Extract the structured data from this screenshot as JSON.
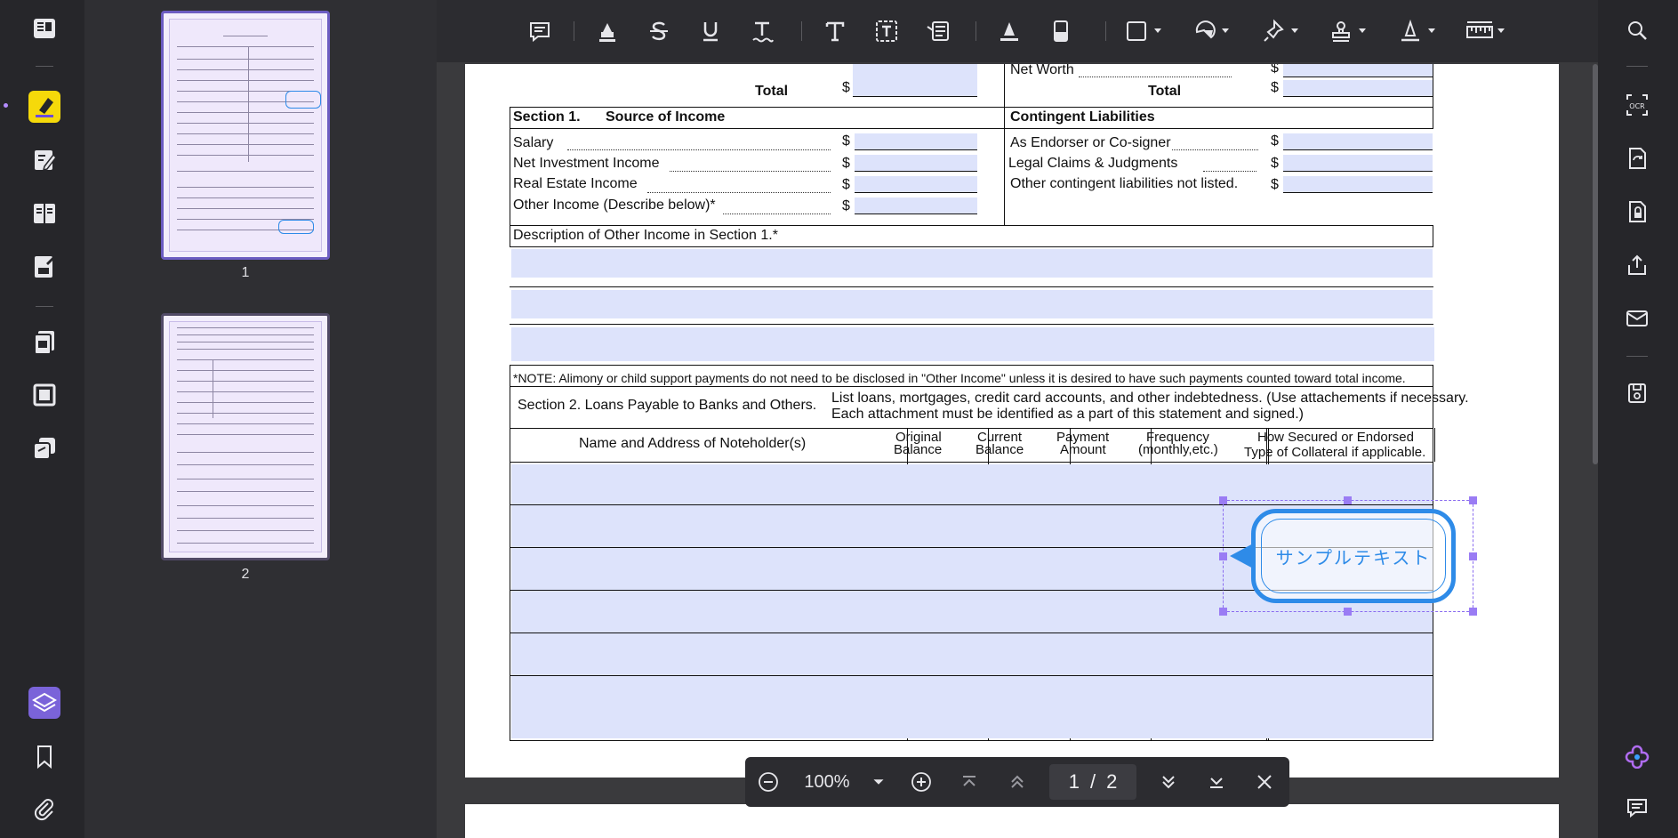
{
  "toolbar": {
    "tools": [
      "comment",
      "highlight",
      "strikethrough",
      "underline",
      "squiggly-underline",
      "text",
      "text-box",
      "text-callout",
      "pencil",
      "eraser",
      "shape",
      "area",
      "pin",
      "stamp",
      "signature",
      "measure"
    ]
  },
  "left_rail": {
    "items": [
      "reader",
      "comment",
      "edit",
      "organize",
      "form",
      "convert",
      "crop",
      "batch",
      "layers",
      "bookmark",
      "attachment"
    ]
  },
  "thumbnails": {
    "pages": [
      {
        "number": "1",
        "selected": true
      },
      {
        "number": "2",
        "selected": false
      }
    ]
  },
  "document": {
    "top_left_total": "Total",
    "top_left_currency": "$",
    "net_worth": "Net Worth",
    "net_worth_currency": "$",
    "top_right_total": "Total",
    "top_right_currency": "$",
    "section1_label": "Section 1.",
    "section1_title": "Source of Income",
    "contingent_title": "Contingent Liabilities",
    "income_rows": [
      {
        "label": "Salary",
        "currency": "$"
      },
      {
        "label": "Net Investment Income",
        "currency": "$"
      },
      {
        "label": "Real Estate Income",
        "currency": "$"
      },
      {
        "label": "Other Income (Describe below)*",
        "currency": "$"
      }
    ],
    "contingent_rows": [
      {
        "label": "As Endorser or Co-signer",
        "currency": "$"
      },
      {
        "label": "Legal Claims & Judgments",
        "currency": "$"
      },
      {
        "label": "Other contingent liabilities not listed.",
        "currency": "$"
      }
    ],
    "description_label": "Description of Other Income in Section 1.*",
    "note": "*NOTE: Alimony or child support payments do not need to be disclosed in \"Other Income\" unless it is desired to have such payments counted toward total income.",
    "section2_title": "Section 2. Loans Payable to Banks and Others.",
    "section2_instr_1": "List loans, mortgages, credit card accounts, and other indebtedness. (Use attachements if necessary.",
    "section2_instr_2": "Each attachment must be identified as a part of this statement and signed.)",
    "columns": {
      "name": "Name and Address of Noteholder(s)",
      "original_1": "Original",
      "original_2": "Balance",
      "current_1": "Current",
      "current_2": "Balance",
      "payment_1": "Payment",
      "payment_2": "Amount",
      "frequency_1": "Frequency",
      "frequency_2": "(monthly,etc.)",
      "secured_1": "How Secured or Endorsed",
      "secured_2": "Type of Collateral if applicable."
    },
    "callout_text": "サンプルテキスト"
  },
  "zoombar": {
    "zoom": "100%",
    "current_page": "1",
    "separator": "/",
    "total_pages": "2"
  },
  "right_rail": {
    "items": [
      "search",
      "ocr",
      "convert",
      "protect",
      "share",
      "email",
      "save",
      "ai-assistant",
      "comments"
    ]
  },
  "colors": {
    "field_fill": "#dde3fb",
    "annotation_blue": "#2e8be8",
    "selection_purple": "#9a7cf4",
    "highlight_yellow": "#f5d90a"
  }
}
